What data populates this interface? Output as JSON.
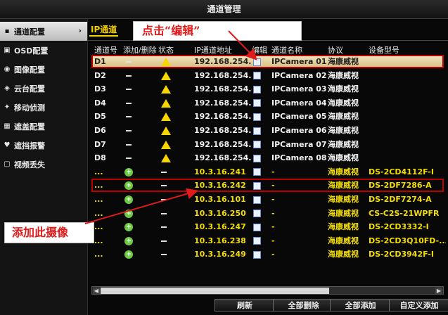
{
  "window": {
    "title": "通道管理"
  },
  "sidebar": {
    "items": [
      {
        "label": "通道配置",
        "icon": "camera-icon",
        "active": true
      },
      {
        "label": "OSD配置",
        "icon": "osd-icon"
      },
      {
        "label": "图像配置",
        "icon": "image-icon"
      },
      {
        "label": "云台配置",
        "icon": "ptz-icon"
      },
      {
        "label": "移动侦测",
        "icon": "motion-icon"
      },
      {
        "label": "遮盖配置",
        "icon": "mask-icon"
      },
      {
        "label": "遮挡报警",
        "icon": "alarm-icon"
      },
      {
        "label": "视频丢失",
        "icon": "video-loss-icon"
      }
    ]
  },
  "tabs": [
    {
      "label": "IP通道"
    }
  ],
  "table": {
    "headers": {
      "ch": "通道号",
      "add": "添加/删除",
      "st": "状态",
      "ip": "IP通道地址",
      "ed": "编辑",
      "nm": "通道名称",
      "pr": "协议",
      "md": "设备型号"
    },
    "rows": [
      {
        "ch": "D1",
        "ip": "192.168.254.2",
        "nm": "IPCamera 01",
        "pr": "海康威视",
        "md": "",
        "selected": true
      },
      {
        "ch": "D2",
        "ip": "192.168.254.3",
        "nm": "IPCamera 02",
        "pr": "海康威视",
        "md": ""
      },
      {
        "ch": "D3",
        "ip": "192.168.254.4",
        "nm": "IPCamera 03",
        "pr": "海康威视",
        "md": ""
      },
      {
        "ch": "D4",
        "ip": "192.168.254.5",
        "nm": "IPCamera 04",
        "pr": "海康威视",
        "md": ""
      },
      {
        "ch": "D5",
        "ip": "192.168.254.6",
        "nm": "IPCamera 05",
        "pr": "海康威视",
        "md": ""
      },
      {
        "ch": "D6",
        "ip": "192.168.254.7",
        "nm": "IPCamera 06",
        "pr": "海康威视",
        "md": ""
      },
      {
        "ch": "D7",
        "ip": "192.168.254.8",
        "nm": "IPCamera 07",
        "pr": "海康威视",
        "md": ""
      },
      {
        "ch": "D8",
        "ip": "192.168.254.9",
        "nm": "IPCamera 08",
        "pr": "海康威视",
        "md": ""
      }
    ],
    "discovered": [
      {
        "ch": "...",
        "ip": "10.3.16.241",
        "nm": "-",
        "pr": "海康威视",
        "md": "DS-2CD4112F-I"
      },
      {
        "ch": "...",
        "ip": "10.3.16.242",
        "nm": "-",
        "pr": "海康威视",
        "md": "DS-2DF7286-A"
      },
      {
        "ch": "...",
        "ip": "10.3.16.101",
        "nm": "-",
        "pr": "海康威视",
        "md": "DS-2DF7274-A"
      },
      {
        "ch": "...",
        "ip": "10.3.16.250",
        "nm": "-",
        "pr": "海康威视",
        "md": "CS-C2S-21WPFR"
      },
      {
        "ch": "...",
        "ip": "10.3.16.247",
        "nm": "-",
        "pr": "海康威视",
        "md": "DS-2CD3332-I"
      },
      {
        "ch": "...",
        "ip": "10.3.16.238",
        "nm": "-",
        "pr": "海康威视",
        "md": "DS-2CD3Q10FD-..."
      },
      {
        "ch": "...",
        "ip": "10.3.16.249",
        "nm": "-",
        "pr": "海康威视",
        "md": "DS-2CD3942F-I"
      }
    ]
  },
  "buttons": {
    "refresh": "刷新",
    "delete_all": "全部删除",
    "add_all": "全部添加",
    "custom_add": "自定义添加"
  },
  "callouts": {
    "edit": "点击“编辑”",
    "add": "添加此摄像"
  },
  "colors": {
    "accent": "#f3dc00",
    "highlight": "#b00000",
    "selected_row": "#e6d2a4"
  }
}
